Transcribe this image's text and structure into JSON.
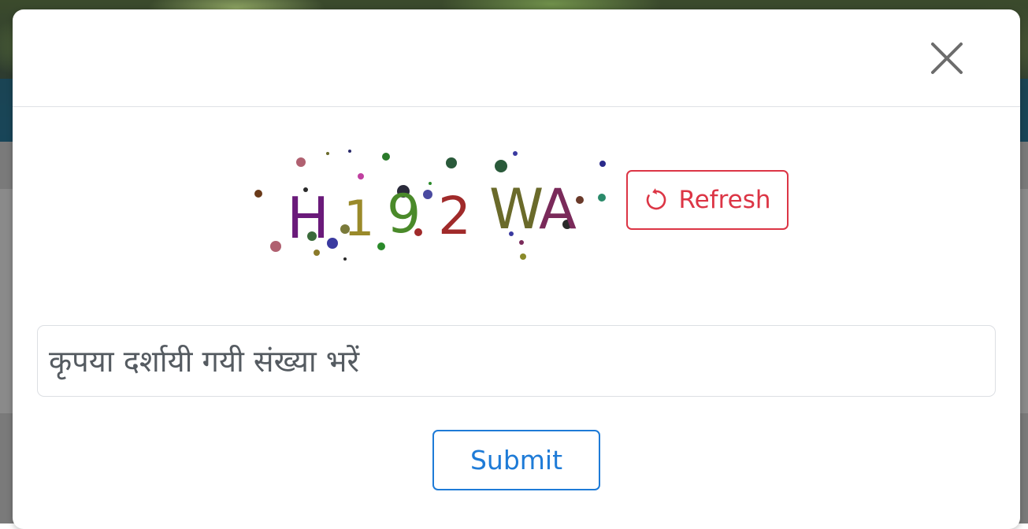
{
  "modal": {
    "close_icon": "close-icon"
  },
  "captcha": {
    "text": "H19 2WA",
    "characters": [
      {
        "char": "H",
        "color": "#6a1a7a"
      },
      {
        "char": "1",
        "color": "#9a8a2a"
      },
      {
        "char": "9",
        "color": "#4a8a2a"
      },
      {
        "char": "2",
        "color": "#a02a2a"
      },
      {
        "char": "W",
        "color": "#6a6a2a"
      },
      {
        "char": "A",
        "color": "#7a2a5a"
      }
    ],
    "refresh_label": "Refresh",
    "refresh_icon": "refresh-icon"
  },
  "form": {
    "input_placeholder": "कृपया दर्शायी गयी संख्या भरें",
    "input_value": "",
    "submit_label": "Submit"
  },
  "colors": {
    "refresh_accent": "#dc3545",
    "submit_accent": "#1e7bd7"
  }
}
